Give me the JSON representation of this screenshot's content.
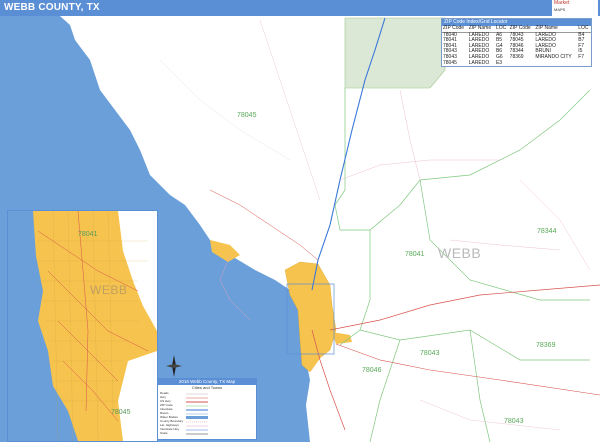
{
  "header": {
    "title": "WEBB COUNTY, TX"
  },
  "logo": {
    "line1": "Market",
    "line2": "MAPS"
  },
  "locator": {
    "title": "ZIP Code Index/Grid Locator",
    "columns": [
      "ZIP Code",
      "ZIP Name",
      "LOC",
      "ZIP Code",
      "ZIP Name",
      "LOC"
    ],
    "rows": [
      [
        "78040",
        "LAREDO",
        "A6",
        "78043",
        "LAREDO",
        "B4"
      ],
      [
        "78041",
        "LAREDO",
        "B5",
        "78045",
        "LAREDO",
        "B7"
      ],
      [
        "78041",
        "LAREDO",
        "G4",
        "78046",
        "LAREDO",
        "F7"
      ],
      [
        "78043",
        "LAREDO",
        "B6",
        "78344",
        "BRUNI",
        "I5"
      ],
      [
        "78043",
        "LAREDO",
        "G6",
        "78369",
        "MIRANDO CITY",
        "F7"
      ],
      [
        "78045",
        "LAREDO",
        "E3",
        "",
        "",
        ""
      ]
    ]
  },
  "map_labels": {
    "county": "WEBB",
    "inset_county": "WEBB",
    "zips": [
      "78045",
      "78344",
      "78041",
      "78043",
      "78046",
      "78369",
      "78043",
      "78041",
      "78045"
    ]
  },
  "legend": {
    "title": "2016 Webb County, TX Map",
    "subtitle": "Cities and Towns",
    "rows": [
      "Roads",
      "Hwy",
      "US Hwy",
      "ZIP Code",
      "Interstate",
      "Rivers",
      "Water Bodies",
      "County Boundary",
      "Lat. Highways",
      "Interstate Hwy",
      "Scale"
    ]
  },
  "colors": {
    "header": "#5a8fd6",
    "water": "#6b9fd9",
    "urban": "#f6c34e",
    "zip_boundary": "#80c880",
    "road_major": "#d9534f",
    "road_minor": "#f0a0c0",
    "interstate": "#3a78d8",
    "mexico_tint": "#dce8d6"
  }
}
